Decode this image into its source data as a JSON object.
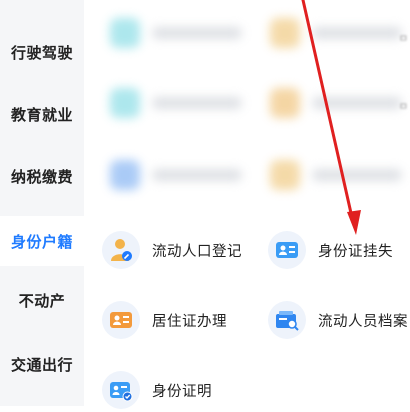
{
  "sidebar": {
    "items": [
      {
        "label": "行驶驾驶",
        "active": false
      },
      {
        "label": "教育就业",
        "active": false
      },
      {
        "label": "纳税缴费",
        "active": false
      },
      {
        "label": "身份户籍",
        "active": true
      },
      {
        "label": "不动产",
        "active": false
      },
      {
        "label": "交通出行",
        "active": false
      }
    ],
    "active_color": "#1f7bff"
  },
  "services": [
    {
      "label": "流动人口登记",
      "icon": "person-edit-icon"
    },
    {
      "label": "身份证挂失",
      "icon": "id-card-icon"
    },
    {
      "label": "居住证办理",
      "icon": "residence-card-icon"
    },
    {
      "label": "流动人员档案",
      "icon": "archive-search-icon"
    },
    {
      "label": "身份证明",
      "icon": "id-check-icon"
    }
  ],
  "annotation": {
    "arrow_color": "#e02020"
  }
}
